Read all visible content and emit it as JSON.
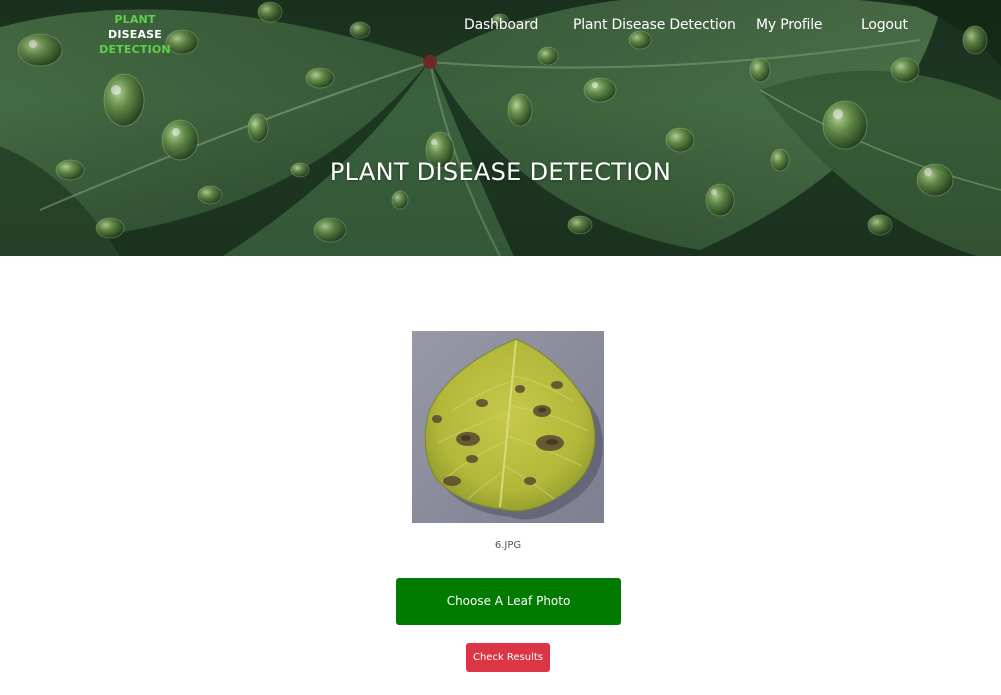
{
  "logo": {
    "word1": "PLANT",
    "word2": "DISEASE",
    "word3": "DETECTION"
  },
  "nav": {
    "items": [
      {
        "label": "Dashboard"
      },
      {
        "label": "Plant Disease Detection"
      },
      {
        "label": "My Profile"
      },
      {
        "label": "Logout"
      }
    ]
  },
  "hero": {
    "title": "PLANT DISEASE DETECTION"
  },
  "upload": {
    "filename": "6.JPG",
    "choose_label": "Choose A Leaf Photo",
    "check_label": "Check Results"
  },
  "colors": {
    "accent_green": "#007b00",
    "logo_green": "#5fd04c",
    "danger_red": "#dc3545"
  }
}
